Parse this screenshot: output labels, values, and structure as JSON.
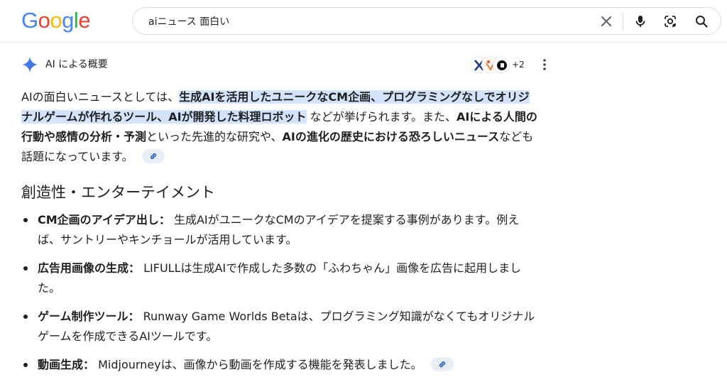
{
  "header": {
    "logo_letters": [
      "G",
      "o",
      "o",
      "g",
      "l",
      "e"
    ],
    "search": {
      "value": "aiニュース 面白い"
    }
  },
  "ai_overview": {
    "title": "AI による概要",
    "sources_more": "+2",
    "summary": {
      "p1": "AIの面白いニュースとしては、",
      "hl": "生成AIを活用したユニークなCM企画、プログラミングなしでオリジナルゲームが作れるツール、AIが開発した料理ロボット",
      "p2": "などが挙げられます。また、",
      "b1": "AIによる人間の行動や感情の分析・予測",
      "p3": "といった先進的な研究や、",
      "b2": "AIの進化の歴史における恐ろしいニュース",
      "p4": "なども話題になっています。"
    },
    "section_heading": "創造性・エンターテイメント",
    "bullets": [
      {
        "term": "CM企画のアイデア出し：",
        "text": " 生成AIがユニークなCMのアイデアを提案する事例があります。例えば、サントリーやキンチョールが活用しています。"
      },
      {
        "term": "広告用画像の生成：",
        "text": " LIFULLは生成AIで作成した多数の「ふわちゃん」画像を広告に起用しました。"
      },
      {
        "term": "ゲーム制作ツール：",
        "text": " Runway Game Worlds Betaは、プログラミング知識がなくてもオリジナルゲームを作成できるAIツールです。"
      },
      {
        "term": "動画生成：",
        "text": " Midjourneyは、画像から動画を作成する機能を発表しました。"
      }
    ]
  },
  "colors": {
    "highlight": "#d3e3fd",
    "text": "#1f1f1f",
    "google_blue": "#4285f4",
    "google_red": "#ea4335",
    "google_yellow": "#fbbc05",
    "google_green": "#34a853"
  }
}
